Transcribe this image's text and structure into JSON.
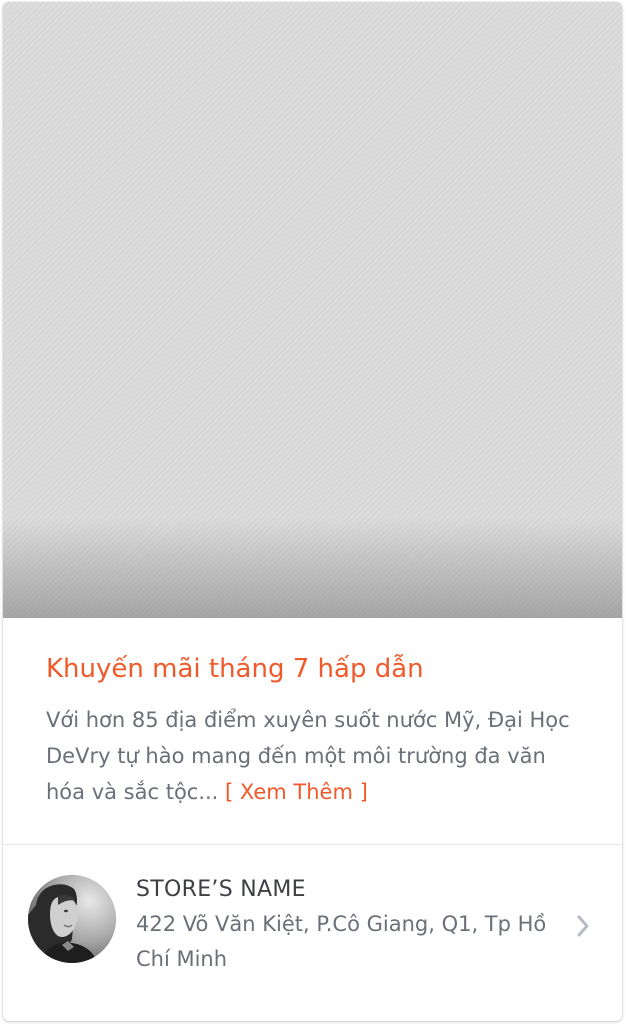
{
  "promo": {
    "title": "Khuyến mãi tháng 7 hấp dẫn",
    "description": "Với hơn 85 địa điểm xuyên suốt nước Mỹ, Đại Học DeVry tự hào mang đến một môi trường đa văn hóa và sắc tộc...",
    "read_more_label": "[ Xem Thêm ]"
  },
  "store": {
    "name": "STORE’S NAME",
    "address": "422 Võ Văn Kiệt, P.Cô Giang, Q1, Tp Hồ Chí Minh",
    "avatar_icon": "person-photo-icon",
    "chevron_icon": "chevron-right-icon"
  },
  "colors": {
    "accent": "#f05a2a",
    "body_text": "#6b6f78",
    "heading_text": "#3d3f44",
    "placeholder_bg": "#d9d9d9"
  }
}
